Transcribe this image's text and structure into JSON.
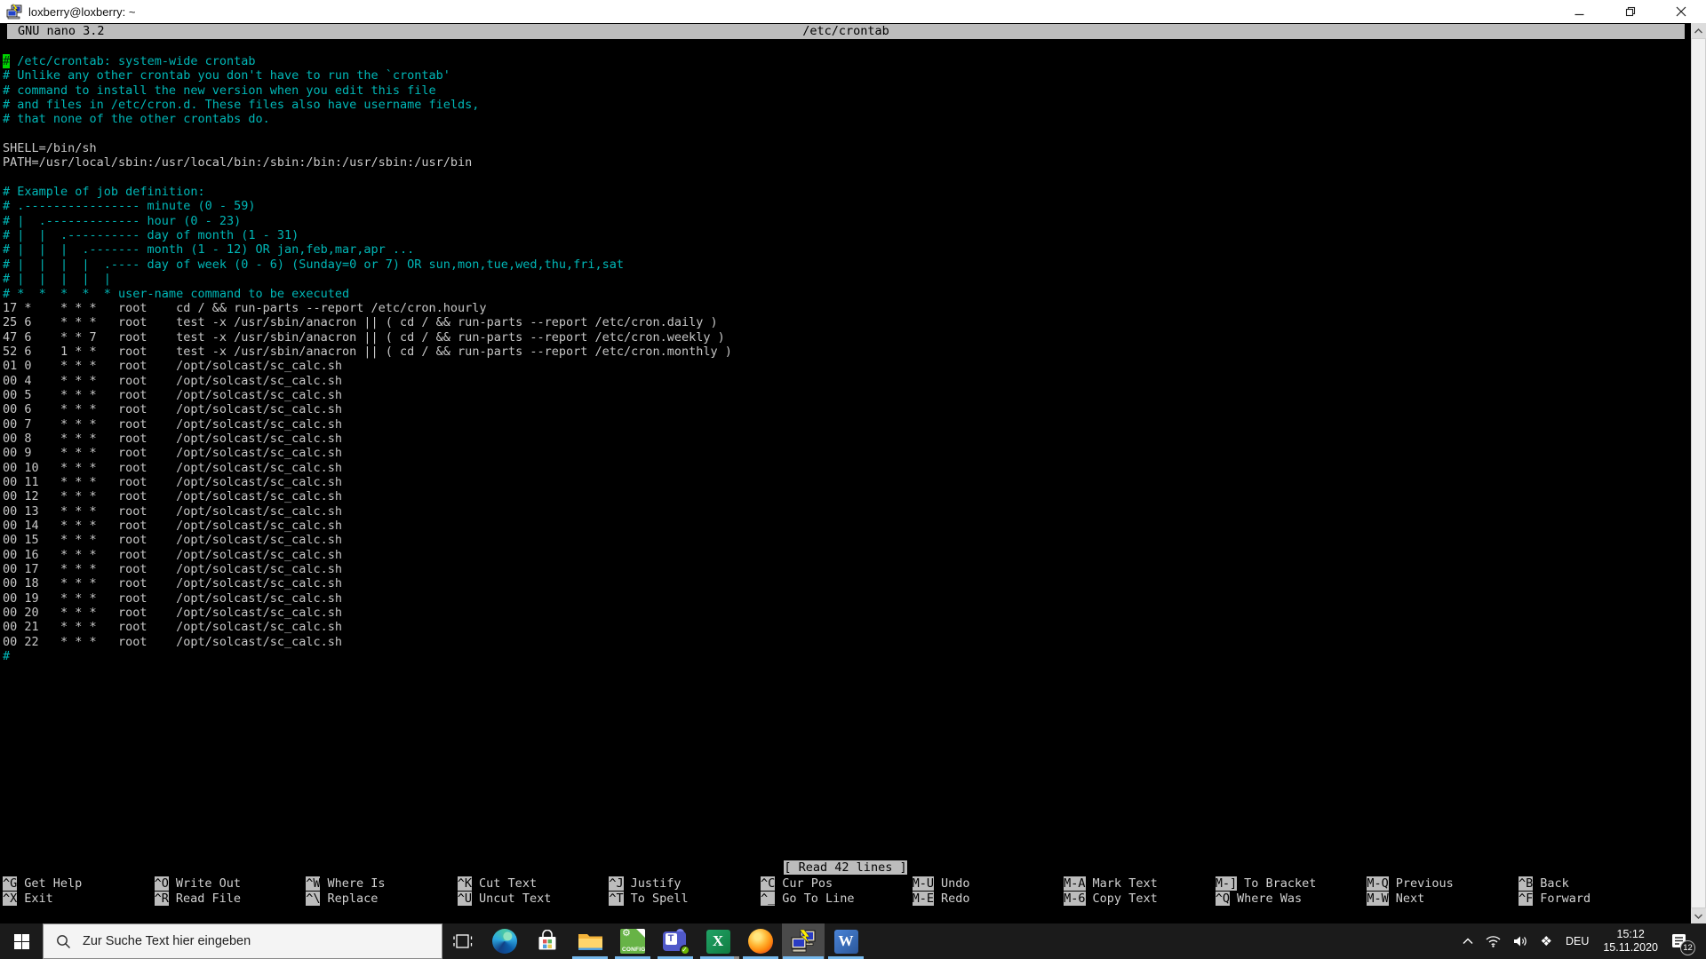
{
  "window": {
    "title": "loxberry@loxberry: ~",
    "controls": [
      {
        "name": "minimize-button"
      },
      {
        "name": "restore-button"
      },
      {
        "name": "close-button"
      }
    ]
  },
  "nano": {
    "header": {
      "version": "GNU nano 3.2",
      "filename": "/etc/crontab"
    },
    "status_message": "[ Read 42 lines ]",
    "colors": {
      "comment": "#00b7b7",
      "text": "#c8c8c8",
      "cursor": "#00d400",
      "bar": "#bcbcbc"
    },
    "buffer_lines": [
      {
        "c": "cyan",
        "cursor": true,
        "t": "# /etc/crontab: system-wide crontab"
      },
      {
        "c": "cyan",
        "t": "# Unlike any other crontab you don't have to run the `crontab'"
      },
      {
        "c": "cyan",
        "t": "# command to install the new version when you edit this file"
      },
      {
        "c": "cyan",
        "t": "# and files in /etc/cron.d. These files also have username fields,"
      },
      {
        "c": "cyan",
        "t": "# that none of the other crontabs do."
      },
      {
        "c": "white",
        "t": ""
      },
      {
        "c": "white",
        "t": "SHELL=/bin/sh"
      },
      {
        "c": "white",
        "t": "PATH=/usr/local/sbin:/usr/local/bin:/sbin:/bin:/usr/sbin:/usr/bin"
      },
      {
        "c": "white",
        "t": ""
      },
      {
        "c": "cyan",
        "t": "# Example of job definition:"
      },
      {
        "c": "cyan",
        "t": "# .---------------- minute (0 - 59)"
      },
      {
        "c": "cyan",
        "t": "# |  .------------- hour (0 - 23)"
      },
      {
        "c": "cyan",
        "t": "# |  |  .---------- day of month (1 - 31)"
      },
      {
        "c": "cyan",
        "t": "# |  |  |  .------- month (1 - 12) OR jan,feb,mar,apr ..."
      },
      {
        "c": "cyan",
        "t": "# |  |  |  |  .---- day of week (0 - 6) (Sunday=0 or 7) OR sun,mon,tue,wed,thu,fri,sat"
      },
      {
        "c": "cyan",
        "t": "# |  |  |  |  |"
      },
      {
        "c": "cyan",
        "t": "# *  *  *  *  * user-name command to be executed"
      },
      {
        "c": "white",
        "t": "17 *\t* * *\troot    cd / && run-parts --report /etc/cron.hourly"
      },
      {
        "c": "white",
        "t": "25 6\t* * *\troot\ttest -x /usr/sbin/anacron || ( cd / && run-parts --report /etc/cron.daily )"
      },
      {
        "c": "white",
        "t": "47 6\t* * 7\troot\ttest -x /usr/sbin/anacron || ( cd / && run-parts --report /etc/cron.weekly )"
      },
      {
        "c": "white",
        "t": "52 6\t1 * *\troot\ttest -x /usr/sbin/anacron || ( cd / && run-parts --report /etc/cron.monthly )"
      },
      {
        "c": "white",
        "t": "01 0\t* * *\troot\t/opt/solcast/sc_calc.sh"
      },
      {
        "c": "white",
        "t": "00 4\t* * *\troot\t/opt/solcast/sc_calc.sh"
      },
      {
        "c": "white",
        "t": "00 5\t* * *\troot\t/opt/solcast/sc_calc.sh"
      },
      {
        "c": "white",
        "t": "00 6\t* * *\troot\t/opt/solcast/sc_calc.sh"
      },
      {
        "c": "white",
        "t": "00 7\t* * *\troot\t/opt/solcast/sc_calc.sh"
      },
      {
        "c": "white",
        "t": "00 8\t* * *\troot\t/opt/solcast/sc_calc.sh"
      },
      {
        "c": "white",
        "t": "00 9\t* * *\troot\t/opt/solcast/sc_calc.sh"
      },
      {
        "c": "white",
        "t": "00 10\t* * *\troot\t/opt/solcast/sc_calc.sh"
      },
      {
        "c": "white",
        "t": "00 11\t* * *\troot\t/opt/solcast/sc_calc.sh"
      },
      {
        "c": "white",
        "t": "00 12\t* * *\troot\t/opt/solcast/sc_calc.sh"
      },
      {
        "c": "white",
        "t": "00 13\t* * *\troot\t/opt/solcast/sc_calc.sh"
      },
      {
        "c": "white",
        "t": "00 14\t* * *\troot\t/opt/solcast/sc_calc.sh"
      },
      {
        "c": "white",
        "t": "00 15\t* * *\troot\t/opt/solcast/sc_calc.sh"
      },
      {
        "c": "white",
        "t": "00 16\t* * *\troot\t/opt/solcast/sc_calc.sh"
      },
      {
        "c": "white",
        "t": "00 17\t* * *\troot\t/opt/solcast/sc_calc.sh"
      },
      {
        "c": "white",
        "t": "00 18\t* * *\troot\t/opt/solcast/sc_calc.sh"
      },
      {
        "c": "white",
        "t": "00 19\t* * *\troot\t/opt/solcast/sc_calc.sh"
      },
      {
        "c": "white",
        "t": "00 20\t* * *\troot\t/opt/solcast/sc_calc.sh"
      },
      {
        "c": "white",
        "t": "00 21\t* * *\troot\t/opt/solcast/sc_calc.sh"
      },
      {
        "c": "white",
        "t": "00 22\t* * *\troot\t/opt/solcast/sc_calc.sh"
      },
      {
        "c": "cyan",
        "t": "#"
      }
    ],
    "shortcuts": {
      "row1": [
        {
          "key": "^G",
          "label": "Get Help"
        },
        {
          "key": "^O",
          "label": "Write Out"
        },
        {
          "key": "^W",
          "label": "Where Is"
        },
        {
          "key": "^K",
          "label": "Cut Text"
        },
        {
          "key": "^J",
          "label": "Justify"
        },
        {
          "key": "^C",
          "label": "Cur Pos"
        },
        {
          "key": "M-U",
          "label": "Undo"
        },
        {
          "key": "M-A",
          "label": "Mark Text"
        },
        {
          "key": "M-]",
          "label": "To Bracket"
        },
        {
          "key": "M-Q",
          "label": "Previous"
        },
        {
          "key": "^B",
          "label": "Back"
        }
      ],
      "row2": [
        {
          "key": "^X",
          "label": "Exit"
        },
        {
          "key": "^R",
          "label": "Read File"
        },
        {
          "key": "^\\",
          "label": "Replace"
        },
        {
          "key": "^U",
          "label": "Uncut Text"
        },
        {
          "key": "^T",
          "label": "To Spell"
        },
        {
          "key": "^_",
          "label": "Go To Line"
        },
        {
          "key": "M-E",
          "label": "Redo"
        },
        {
          "key": "M-6",
          "label": "Copy Text"
        },
        {
          "key": "^Q",
          "label": "Where Was"
        },
        {
          "key": "M-W",
          "label": "Next"
        },
        {
          "key": "^F",
          "label": "Forward"
        }
      ]
    }
  },
  "taskbar": {
    "search_placeholder": "Zur Suche Text hier eingeben",
    "accent_underline": "#76b9ed",
    "apps": [
      {
        "id": "edge",
        "name": "microsoft-edge",
        "running": false
      },
      {
        "id": "store",
        "name": "microsoft-store",
        "running": false
      },
      {
        "id": "explorer",
        "name": "file-explorer",
        "running": true
      },
      {
        "id": "config",
        "name": "loxberry-config",
        "running": true,
        "label": "CONFIG"
      },
      {
        "id": "teams",
        "name": "microsoft-teams",
        "running": true,
        "glyph": "T"
      },
      {
        "id": "excel",
        "name": "microsoft-excel",
        "running": true,
        "multi": true,
        "glyph": "X"
      },
      {
        "id": "firefox",
        "name": "firefox",
        "running": true
      },
      {
        "id": "putty",
        "name": "putty",
        "running": true,
        "active": true
      },
      {
        "id": "word",
        "name": "microsoft-word",
        "running": true,
        "glyph": "W"
      }
    ],
    "tray": {
      "language": "DEU",
      "time": "15:12",
      "date": "15.11.2020",
      "notification_badge": "12"
    }
  }
}
